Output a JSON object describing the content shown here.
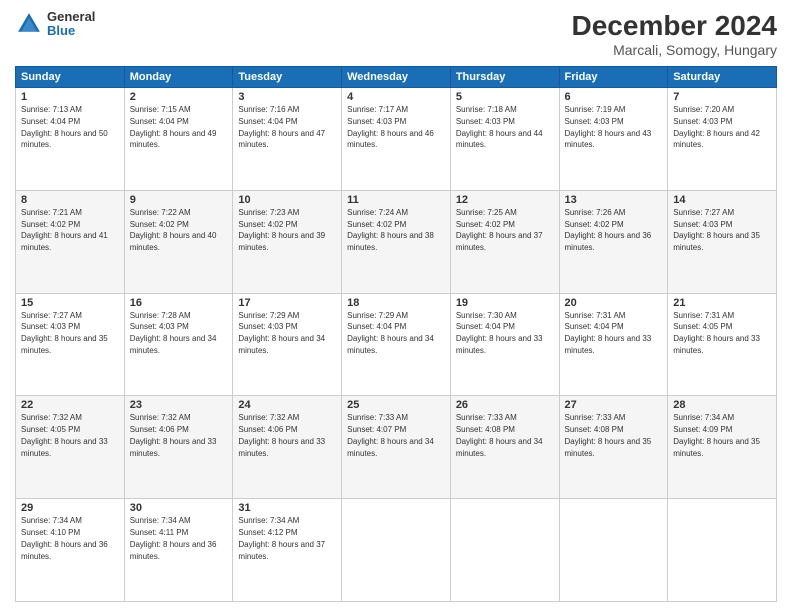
{
  "header": {
    "logo": {
      "line1": "General",
      "line2": "Blue"
    },
    "title": "December 2024",
    "subtitle": "Marcali, Somogy, Hungary"
  },
  "days": [
    "Sunday",
    "Monday",
    "Tuesday",
    "Wednesday",
    "Thursday",
    "Friday",
    "Saturday"
  ],
  "weeks": [
    [
      {
        "day": 1,
        "sunrise": "7:13 AM",
        "sunset": "4:04 PM",
        "daylight": "8 hours and 50 minutes."
      },
      {
        "day": 2,
        "sunrise": "7:15 AM",
        "sunset": "4:04 PM",
        "daylight": "8 hours and 49 minutes."
      },
      {
        "day": 3,
        "sunrise": "7:16 AM",
        "sunset": "4:04 PM",
        "daylight": "8 hours and 47 minutes."
      },
      {
        "day": 4,
        "sunrise": "7:17 AM",
        "sunset": "4:03 PM",
        "daylight": "8 hours and 46 minutes."
      },
      {
        "day": 5,
        "sunrise": "7:18 AM",
        "sunset": "4:03 PM",
        "daylight": "8 hours and 44 minutes."
      },
      {
        "day": 6,
        "sunrise": "7:19 AM",
        "sunset": "4:03 PM",
        "daylight": "8 hours and 43 minutes."
      },
      {
        "day": 7,
        "sunrise": "7:20 AM",
        "sunset": "4:03 PM",
        "daylight": "8 hours and 42 minutes."
      }
    ],
    [
      {
        "day": 8,
        "sunrise": "7:21 AM",
        "sunset": "4:02 PM",
        "daylight": "8 hours and 41 minutes."
      },
      {
        "day": 9,
        "sunrise": "7:22 AM",
        "sunset": "4:02 PM",
        "daylight": "8 hours and 40 minutes."
      },
      {
        "day": 10,
        "sunrise": "7:23 AM",
        "sunset": "4:02 PM",
        "daylight": "8 hours and 39 minutes."
      },
      {
        "day": 11,
        "sunrise": "7:24 AM",
        "sunset": "4:02 PM",
        "daylight": "8 hours and 38 minutes."
      },
      {
        "day": 12,
        "sunrise": "7:25 AM",
        "sunset": "4:02 PM",
        "daylight": "8 hours and 37 minutes."
      },
      {
        "day": 13,
        "sunrise": "7:26 AM",
        "sunset": "4:02 PM",
        "daylight": "8 hours and 36 minutes."
      },
      {
        "day": 14,
        "sunrise": "7:27 AM",
        "sunset": "4:03 PM",
        "daylight": "8 hours and 35 minutes."
      }
    ],
    [
      {
        "day": 15,
        "sunrise": "7:27 AM",
        "sunset": "4:03 PM",
        "daylight": "8 hours and 35 minutes."
      },
      {
        "day": 16,
        "sunrise": "7:28 AM",
        "sunset": "4:03 PM",
        "daylight": "8 hours and 34 minutes."
      },
      {
        "day": 17,
        "sunrise": "7:29 AM",
        "sunset": "4:03 PM",
        "daylight": "8 hours and 34 minutes."
      },
      {
        "day": 18,
        "sunrise": "7:29 AM",
        "sunset": "4:04 PM",
        "daylight": "8 hours and 34 minutes."
      },
      {
        "day": 19,
        "sunrise": "7:30 AM",
        "sunset": "4:04 PM",
        "daylight": "8 hours and 33 minutes."
      },
      {
        "day": 20,
        "sunrise": "7:31 AM",
        "sunset": "4:04 PM",
        "daylight": "8 hours and 33 minutes."
      },
      {
        "day": 21,
        "sunrise": "7:31 AM",
        "sunset": "4:05 PM",
        "daylight": "8 hours and 33 minutes."
      }
    ],
    [
      {
        "day": 22,
        "sunrise": "7:32 AM",
        "sunset": "4:05 PM",
        "daylight": "8 hours and 33 minutes."
      },
      {
        "day": 23,
        "sunrise": "7:32 AM",
        "sunset": "4:06 PM",
        "daylight": "8 hours and 33 minutes."
      },
      {
        "day": 24,
        "sunrise": "7:32 AM",
        "sunset": "4:06 PM",
        "daylight": "8 hours and 33 minutes."
      },
      {
        "day": 25,
        "sunrise": "7:33 AM",
        "sunset": "4:07 PM",
        "daylight": "8 hours and 34 minutes."
      },
      {
        "day": 26,
        "sunrise": "7:33 AM",
        "sunset": "4:08 PM",
        "daylight": "8 hours and 34 minutes."
      },
      {
        "day": 27,
        "sunrise": "7:33 AM",
        "sunset": "4:08 PM",
        "daylight": "8 hours and 35 minutes."
      },
      {
        "day": 28,
        "sunrise": "7:34 AM",
        "sunset": "4:09 PM",
        "daylight": "8 hours and 35 minutes."
      }
    ],
    [
      {
        "day": 29,
        "sunrise": "7:34 AM",
        "sunset": "4:10 PM",
        "daylight": "8 hours and 36 minutes."
      },
      {
        "day": 30,
        "sunrise": "7:34 AM",
        "sunset": "4:11 PM",
        "daylight": "8 hours and 36 minutes."
      },
      {
        "day": 31,
        "sunrise": "7:34 AM",
        "sunset": "4:12 PM",
        "daylight": "8 hours and 37 minutes."
      },
      null,
      null,
      null,
      null
    ]
  ]
}
